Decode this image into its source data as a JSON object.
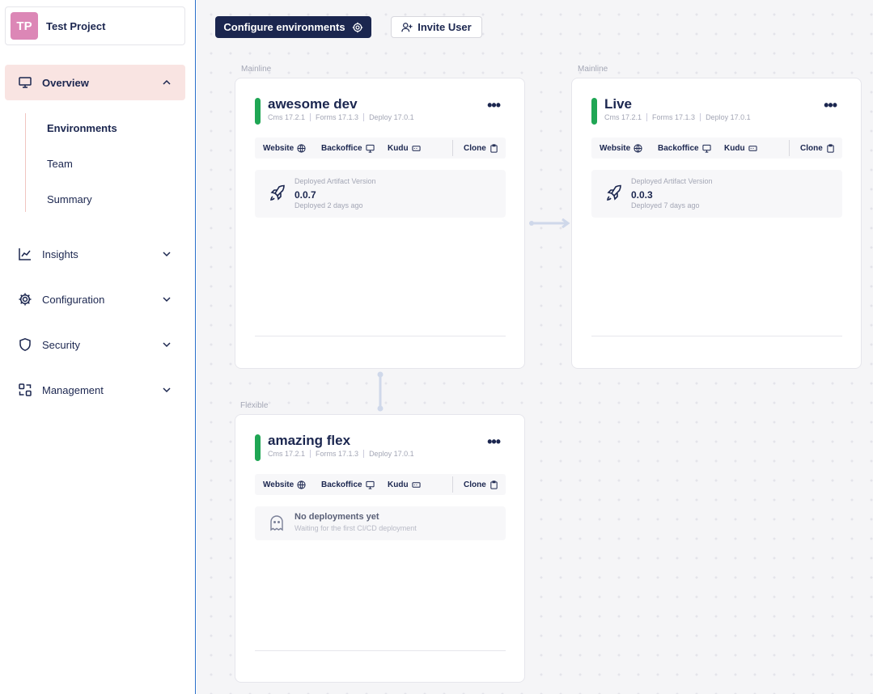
{
  "project": {
    "initials": "TP",
    "name": "Test Project",
    "avatar_color": "#dc87b6"
  },
  "sidebar": {
    "overview": {
      "label": "Overview",
      "icon": "monitor-icon",
      "expanded": true
    },
    "subitems": [
      "Environments",
      "Team",
      "Summary"
    ],
    "items": [
      {
        "label": "Insights",
        "icon": "chart-icon"
      },
      {
        "label": "Configuration",
        "icon": "gear-icon"
      },
      {
        "label": "Security",
        "icon": "shield-icon"
      },
      {
        "label": "Management",
        "icon": "management-icon"
      }
    ]
  },
  "toolbar": {
    "configure_label": "Configure environments",
    "invite_label": "Invite User"
  },
  "groups": {
    "mainline": "Mainline",
    "flexible": "Flexible"
  },
  "actions": {
    "website": "Website",
    "backoffice": "Backoffice",
    "kudu": "Kudu",
    "clone": "Clone"
  },
  "environments": [
    {
      "name": "awesome dev",
      "group": "Mainline",
      "cms": "Cms 17.2.1",
      "forms": "Forms 17.1.3",
      "deploy": "Deploy 17.0.1",
      "deployment": {
        "title": "Deployed Artifact Version",
        "version": "0.0.7",
        "when": "Deployed 2 days ago"
      }
    },
    {
      "name": "Live",
      "group": "Mainline",
      "cms": "Cms 17.2.1",
      "forms": "Forms 17.1.3",
      "deploy": "Deploy 17.0.1",
      "deployment": {
        "title": "Deployed Artifact Version",
        "version": "0.0.3",
        "when": "Deployed 7 days ago"
      }
    },
    {
      "name": "amazing flex",
      "group": "Flexible",
      "cms": "Cms 17.2.1",
      "forms": "Forms 17.1.3",
      "deploy": "Deploy 17.0.1",
      "empty": {
        "title": "No deployments yet",
        "subtitle": "Waiting for the first CI/CD deployment"
      }
    }
  ],
  "colors": {
    "status_ok": "#1fa654",
    "primary": "#1b264f",
    "accent_bg": "#f9e4e2"
  }
}
